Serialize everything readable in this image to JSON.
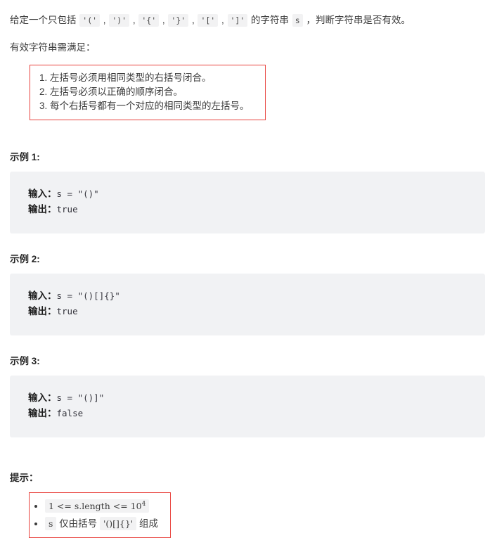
{
  "problem": {
    "intro": {
      "prefix": "给定一个只包括 ",
      "tokens": [
        "'('",
        "')'",
        "'{'",
        "'}'",
        "'['",
        "']'"
      ],
      "sep": " , ",
      "middle": " 的字符串 ",
      "var": "s",
      "suffix": " ，判断字符串是否有效。"
    },
    "condition_label": "有效字符串需满足：",
    "rules": [
      "左括号必须用相同类型的右括号闭合。",
      "左括号必须以正确的顺序闭合。",
      "每个右括号都有一个对应的相同类型的左括号。"
    ]
  },
  "examples": [
    {
      "heading": "示例 1:",
      "input_label": "输入：",
      "input_code": "s = \"()\"",
      "output_label": "输出：",
      "output_code": "true"
    },
    {
      "heading": "示例 2:",
      "input_label": "输入：",
      "input_code": "s = \"()[]{}\"",
      "output_label": "输出：",
      "output_code": "true"
    },
    {
      "heading": "示例 3:",
      "input_label": "输入：",
      "input_code": "s = \"()]\"",
      "output_label": "输出：",
      "output_code": "false"
    }
  ],
  "hints": {
    "heading": "提示：",
    "items": [
      {
        "code_main": "1 <= s.length <= 10",
        "code_sup": "4"
      },
      {
        "var": "s",
        "text_before": " 仅由括号 ",
        "code": "'()[]{}'",
        "text_after": " 组成"
      }
    ]
  },
  "colors": {
    "red_border": "#e8413c",
    "code_bg": "#f2f2f3",
    "block_bg": "#f1f2f4",
    "text": "#3b3b3b"
  }
}
